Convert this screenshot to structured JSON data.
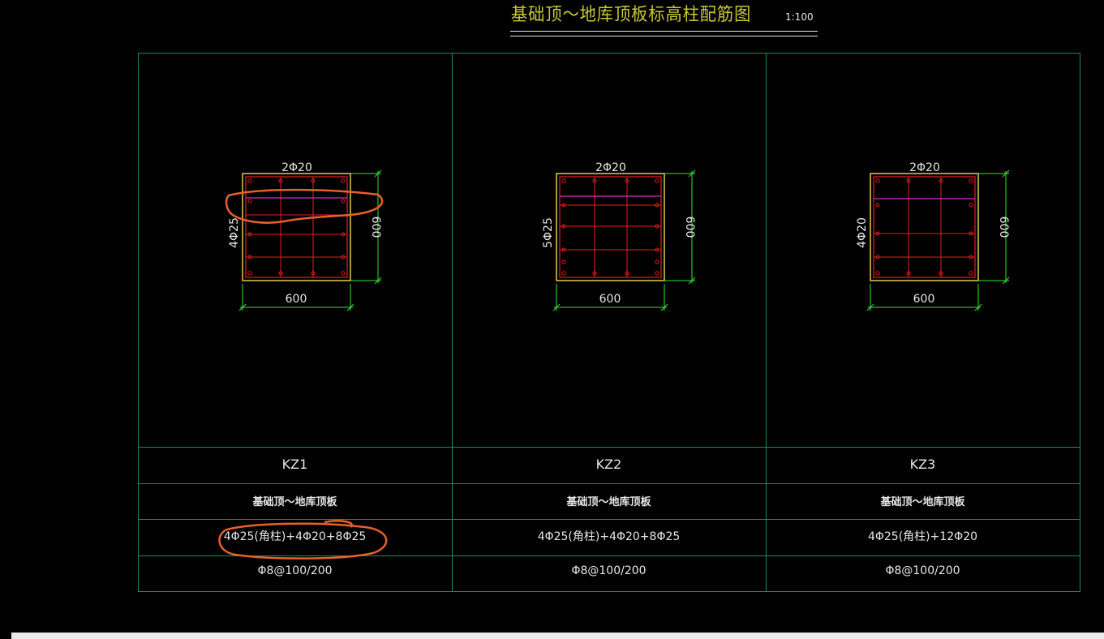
{
  "header": {
    "title": "基础顶～地库顶板标高柱配筋图",
    "scale": "1:100"
  },
  "columns": [
    {
      "name": "KZ1",
      "top_rebar": "2Φ20",
      "side_rebar": "4Φ25",
      "width": "600",
      "height": "600",
      "elevation_range": "基础顶～地库顶板",
      "longitudinal_rebar": "4Φ25(角柱)+4Φ20+8Φ25",
      "stirrup": "Φ8@100/200"
    },
    {
      "name": "KZ2",
      "top_rebar": "2Φ20",
      "side_rebar": "5Φ25",
      "width": "600",
      "height": "600",
      "elevation_range": "基础顶～地库顶板",
      "longitudinal_rebar": "4Φ25(角柱)+4Φ20+8Φ25",
      "stirrup": "Φ8@100/200"
    },
    {
      "name": "KZ3",
      "top_rebar": "2Φ20",
      "side_rebar": "4Φ20",
      "width": "600",
      "height": "600",
      "elevation_range": "基础顶～地库顶板",
      "longitudinal_rebar": "4Φ25(角柱)+12Φ20",
      "stirrup": "Φ8@100/200"
    }
  ],
  "colors": {
    "grid": "#1f8a5a",
    "title": "#c8c832",
    "section_outline": "#e6c84a",
    "stirrup": "#e02020",
    "tie": "#d030d0",
    "dimension": "#32e632",
    "annotation": "#e8602a"
  }
}
